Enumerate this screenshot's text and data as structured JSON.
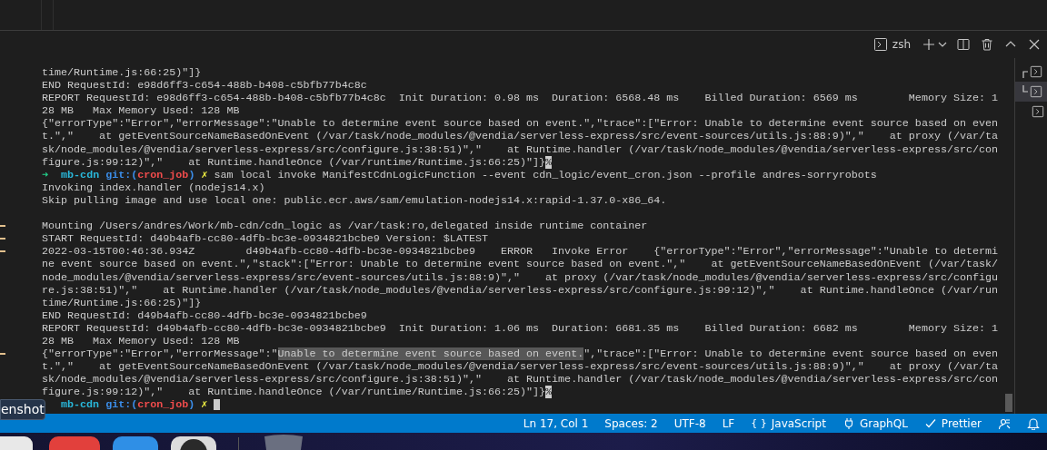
{
  "panel": {
    "terminal_name": "zsh"
  },
  "terminal_lines": [
    {
      "segments": [
        {
          "kind": "plain",
          "text": "time/Runtime.js:66:25)\"]}"
        }
      ]
    },
    {
      "segments": [
        {
          "kind": "plain",
          "text": "END RequestId: e98d6ff3-c654-488b-b408-c5bfb77b4c8c"
        }
      ]
    },
    {
      "segments": [
        {
          "kind": "plain",
          "text": "REPORT RequestId: e98d6ff3-c654-488b-b408-c5bfb77b4c8c  Init Duration: 0.98 ms  Duration: 6568.48 ms    Billed Duration: 6569 ms        Memory Size: 1"
        }
      ]
    },
    {
      "segments": [
        {
          "kind": "plain",
          "text": "28 MB   Max Memory Used: 128 MB"
        }
      ]
    },
    {
      "segments": [
        {
          "kind": "plain",
          "text": "{\"errorType\":\"Error\",\"errorMessage\":\"Unable to determine event source based on event.\",\"trace\":[\"Error: Unable to determine event source based on even"
        }
      ]
    },
    {
      "segments": [
        {
          "kind": "plain",
          "text": "t.\",\"    at getEventSourceNameBasedOnEvent (/var/task/node_modules/@vendia/serverless-express/src/event-sources/utils.js:88:9)\",\"    at proxy (/var/ta"
        }
      ]
    },
    {
      "segments": [
        {
          "kind": "plain",
          "text": "sk/node_modules/@vendia/serverless-express/src/configure.js:38:51)\",\"    at Runtime.handler (/var/task/node_modules/@vendia/serverless-express/src/con"
        }
      ]
    },
    {
      "segments": [
        {
          "kind": "plain",
          "text": "figure.js:99:12)\",\"    at Runtime.handleOnce (/var/runtime/Runtime.js:66:25)\"]}"
        },
        {
          "kind": "inverse",
          "text": "%"
        }
      ]
    },
    {
      "segments": [
        {
          "kind": "arrow",
          "text": "➜  "
        },
        {
          "kind": "dir",
          "text": "mb-cdn "
        },
        {
          "kind": "git",
          "text": "git:("
        },
        {
          "kind": "branch",
          "text": "cron_job"
        },
        {
          "kind": "git",
          "text": ")"
        },
        {
          "kind": "dirty",
          "text": " ✗"
        },
        {
          "kind": "plain",
          "text": " sam local invoke ManifestCdnLogicFunction --event cdn_logic/event_cron.json --profile andres-sorryrobots"
        }
      ]
    },
    {
      "segments": [
        {
          "kind": "plain",
          "text": "Invoking index.handler (nodejs14.x)"
        }
      ]
    },
    {
      "segments": [
        {
          "kind": "plain",
          "text": "Skip pulling image and use local one: public.ecr.aws/sam/emulation-nodejs14.x:rapid-1.37.0-x86_64."
        }
      ]
    },
    {
      "kind": "blank"
    },
    {
      "marked": true,
      "segments": [
        {
          "kind": "plain",
          "text": "Mounting /Users/andres/Work/mb-cdn/cdn_logic as /var/task:ro,delegated inside runtime container"
        }
      ]
    },
    {
      "marked": true,
      "segments": [
        {
          "kind": "plain",
          "text": "START RequestId: d49b4afb-cc80-4dfb-bc3e-0934821bcbe9 Version: $LATEST"
        }
      ]
    },
    {
      "marked": true,
      "segments": [
        {
          "kind": "plain",
          "text": "2022-03-15T00:46:36.934Z        d49b4afb-cc80-4dfb-bc3e-0934821bcbe9    ERROR   Invoke Error    {\"errorType\":\"Error\",\"errorMessage\":\"Unable to determi"
        }
      ]
    },
    {
      "segments": [
        {
          "kind": "plain",
          "text": "ne event source based on event.\",\"stack\":[\"Error: Unable to determine event source based on event.\",\"    at getEventSourceNameBasedOnEvent (/var/task/"
        }
      ]
    },
    {
      "segments": [
        {
          "kind": "plain",
          "text": "node_modules/@vendia/serverless-express/src/event-sources/utils.js:88:9)\",\"    at proxy (/var/task/node_modules/@vendia/serverless-express/src/configu"
        }
      ]
    },
    {
      "segments": [
        {
          "kind": "plain",
          "text": "re.js:38:51)\",\"    at Runtime.handler (/var/task/node_modules/@vendia/serverless-express/src/configure.js:99:12)\",\"    at Runtime.handleOnce (/var/run"
        }
      ]
    },
    {
      "segments": [
        {
          "kind": "plain",
          "text": "time/Runtime.js:66:25)\"]}"
        }
      ]
    },
    {
      "segments": [
        {
          "kind": "plain",
          "text": "END RequestId: d49b4afb-cc80-4dfb-bc3e-0934821bcbe9"
        }
      ]
    },
    {
      "segments": [
        {
          "kind": "plain",
          "text": "REPORT RequestId: d49b4afb-cc80-4dfb-bc3e-0934821bcbe9  Init Duration: 1.06 ms  Duration: 6681.35 ms    Billed Duration: 6682 ms        Memory Size: 1"
        }
      ]
    },
    {
      "segments": [
        {
          "kind": "plain",
          "text": "28 MB   Max Memory Used: 128 MB"
        }
      ]
    },
    {
      "marked": true,
      "segments": [
        {
          "kind": "plain",
          "text": "{\"errorType\":\"Error\",\"errorMessage\":\""
        },
        {
          "kind": "selected",
          "text": "Unable to determine event source based on event."
        },
        {
          "kind": "plain",
          "text": "\",\"trace\":[\"Error: Unable to determine event source based on even"
        }
      ]
    },
    {
      "segments": [
        {
          "kind": "plain",
          "text": "t.\",\"    at getEventSourceNameBasedOnEvent (/var/task/node_modules/@vendia/serverless-express/src/event-sources/utils.js:88:9)\",\"    at proxy (/var/ta"
        }
      ]
    },
    {
      "segments": [
        {
          "kind": "plain",
          "text": "sk/node_modules/@vendia/serverless-express/src/configure.js:38:51)\",\"    at Runtime.handler (/var/task/node_modules/@vendia/serverless-express/src/con"
        }
      ]
    },
    {
      "segments": [
        {
          "kind": "plain",
          "text": "figure.js:99:12)\",\"    at Runtime.handleOnce (/var/runtime/Runtime.js:66:25)\"]}"
        },
        {
          "kind": "inverse",
          "text": "%"
        }
      ]
    },
    {
      "cursor": true,
      "segments": [
        {
          "kind": "dir",
          "text": "mb-cdn "
        },
        {
          "kind": "git",
          "text": "git:("
        },
        {
          "kind": "branch",
          "text": "cron_job"
        },
        {
          "kind": "git",
          "text": ")"
        },
        {
          "kind": "dirty",
          "text": " ✗"
        }
      ]
    }
  ],
  "terminal_tabs": [
    {
      "kind": "split-top",
      "selected": false
    },
    {
      "kind": "split-bottom",
      "selected": true
    },
    {
      "kind": "single",
      "selected": false
    }
  ],
  "tooltip": {
    "text": "enshot"
  },
  "status_bar": [
    {
      "kind": "text",
      "label": "Ln 17, Col 1"
    },
    {
      "kind": "text",
      "label": "Spaces: 2"
    },
    {
      "kind": "text",
      "label": "UTF-8"
    },
    {
      "kind": "text",
      "label": "LF"
    },
    {
      "kind": "language",
      "glyph": "{ }",
      "label": "JavaScript"
    },
    {
      "kind": "plug",
      "label": "GraphQL"
    },
    {
      "kind": "check",
      "label": "Prettier"
    },
    {
      "kind": "feedback"
    },
    {
      "kind": "bell"
    }
  ]
}
